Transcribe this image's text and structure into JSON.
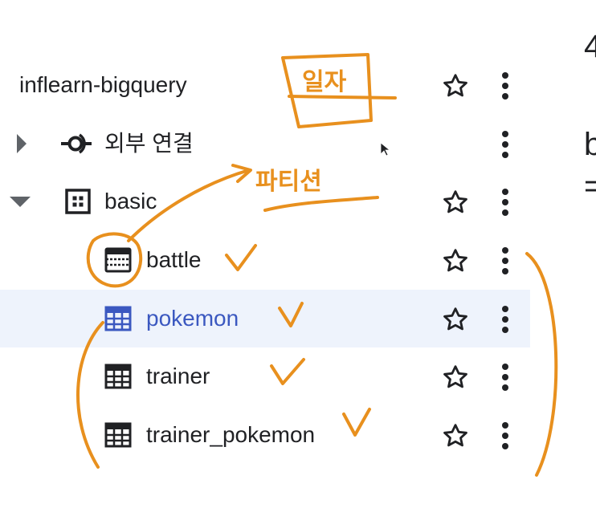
{
  "explorer": {
    "project": {
      "label": "inflearn-bigquery",
      "starred": false
    },
    "connections": {
      "label": "외부 연결",
      "expanded": false
    },
    "dataset": {
      "label": "basic",
      "expanded": true,
      "tables": [
        {
          "label": "battle",
          "icon": "partitioned-table-icon",
          "selected": false
        },
        {
          "label": "pokemon",
          "icon": "table-icon",
          "selected": true
        },
        {
          "label": "trainer",
          "icon": "table-icon",
          "selected": false
        },
        {
          "label": "trainer_pokemon",
          "icon": "table-icon",
          "selected": false
        }
      ]
    }
  },
  "right_panel": {
    "fragments": [
      "4",
      "b",
      "="
    ]
  },
  "annotations": {
    "date_label": "일자",
    "partition_label": "파티션"
  },
  "colors": {
    "selected_bg": "#eef3fc",
    "selected_text": "#3b58c0",
    "annotation": "#e8901e",
    "text": "#202124"
  }
}
